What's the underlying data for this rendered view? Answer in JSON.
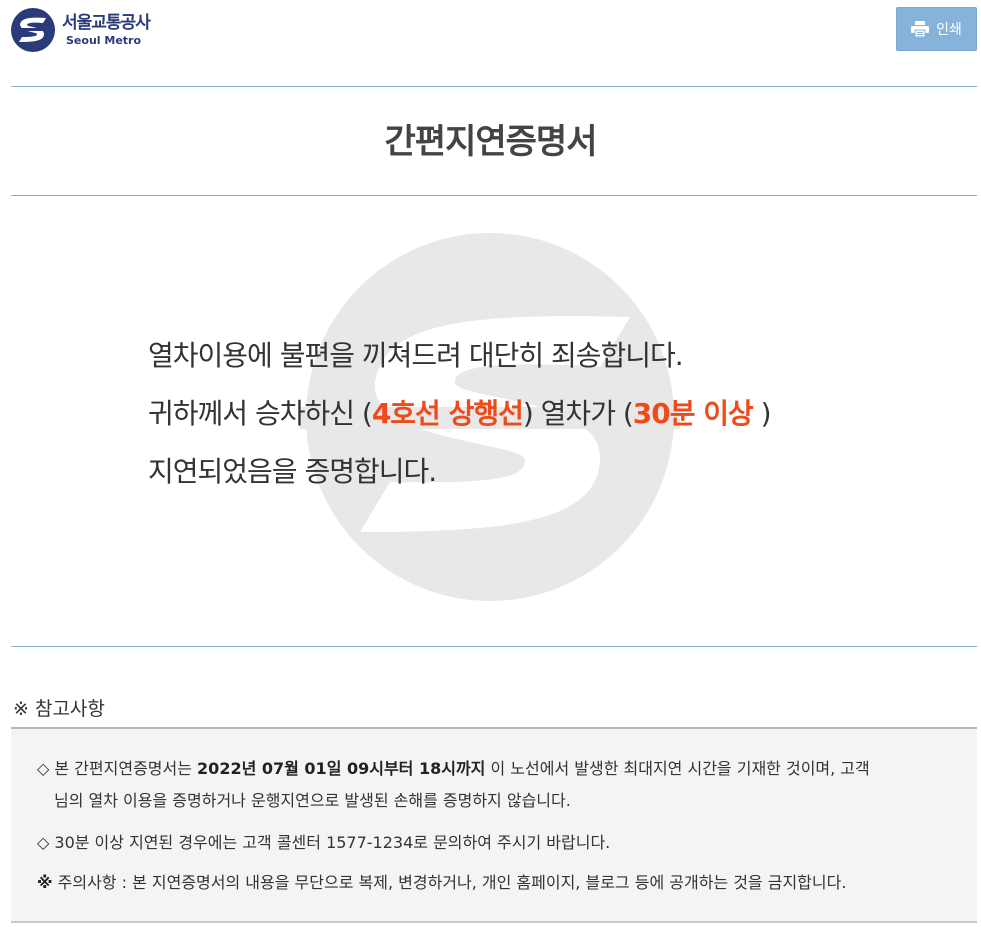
{
  "header": {
    "logo_ko": "서울교통공사",
    "logo_en": "Seoul Metro",
    "print_label": "인쇄"
  },
  "certificate": {
    "title": "간편지연증명서",
    "line1": "열차이용에 불편을 끼쳐드려 대단히 죄송합니다.",
    "line2_prefix": "귀하께서 승차하신 (",
    "line_name": "4호선 상행선",
    "line2_middle": ") 열차가 (",
    "delay": "30분 이상",
    "line2_suffix": " )",
    "line3": "지연되었음을 증명합니다."
  },
  "notes": {
    "heading": "※ 참고사항",
    "note1_prefix": "◇ 본 간편지연증명서는 ",
    "note1_period": "2022년 07월 01일 09시부터 18시까지",
    "note1_suffix": " 이 노선에서 발생한 최대지연 시간을 기재한 것이며, 고객",
    "note1_cont": "님의 열차 이용을 증명하거나 운행지연으로 발생된 손해를 증명하지 않습니다.",
    "note2": "◇ 30분 이상 지연된 경우에는 고객 콜센터 1577-1234로 문의하여 주시기 바랍니다.",
    "note3_mark": "※",
    "note3": " 주의사항 : 본 지연증명서의 내용을 무단으로 복제, 변경하거나, 개인 홈페이지, 블로그 등에 공개하는 것을 금지합니다."
  },
  "colors": {
    "brand_navy": "#2b3b7a",
    "print_button": "#87b3da",
    "highlight": "#ef4a1b",
    "rule": "#7fb0d6"
  },
  "icons": {
    "logo": "seoul-metro-logo-icon",
    "print": "printer-icon",
    "watermark": "seoul-metro-watermark-icon"
  }
}
